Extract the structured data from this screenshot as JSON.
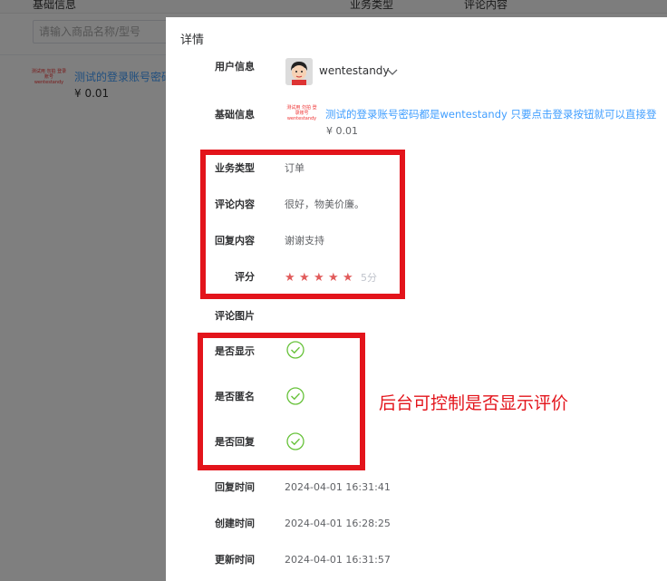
{
  "background": {
    "col_basic_info": "基础信息",
    "col_business_type": "业务类型",
    "col_comment": "评论内容",
    "search_placeholder": "请输入商品名称/型号",
    "product_link": "测试的登录账号密码",
    "product_price": "¥ 0.01",
    "thumb_text": "测试用 勿拍 登录账号 wentestandy"
  },
  "drawer": {
    "title": "详情",
    "user_info_label": "用户信息",
    "username": "wentestandy",
    "basic_info_label": "基础信息",
    "product_title": "测试的登录账号密码都是wentestandy 只要点击登录按钮就可以直接登",
    "product_price": "¥ 0.01",
    "thumb_text": "测试用 勿拍 登录账号 wentestandy",
    "business_type_label": "业务类型",
    "business_type": "订单",
    "comment_label": "评论内容",
    "comment": "很好，物美价廉。",
    "reply_label": "回复内容",
    "reply": "谢谢支持",
    "rating_label": "评分",
    "rating_value": 5,
    "rating_text": "5分",
    "images_label": "评论图片",
    "show_label": "是否显示",
    "anonymous_label": "是否匿名",
    "replied_label": "是否回复",
    "reply_time_label": "回复时间",
    "reply_time": "2024-04-01 16:31:41",
    "create_time_label": "创建时间",
    "create_time": "2024-04-01 16:28:25",
    "update_time_label": "更新时间",
    "update_time": "2024-04-01 16:31:57"
  },
  "annotation": "后台可控制是否显示评价",
  "colors": {
    "link": "#409eff",
    "star": "#e15b5b",
    "check": "#67c23a",
    "annotation": "#e3141b"
  }
}
